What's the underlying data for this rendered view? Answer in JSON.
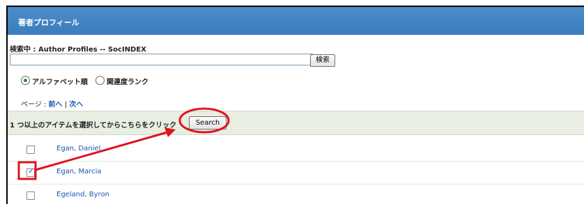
{
  "header": {
    "title": "著者プロフィール"
  },
  "search": {
    "label": "検索中 : Author Profiles -- SocINDEX",
    "placeholder": "",
    "button_label": "検索"
  },
  "sort": {
    "options": [
      {
        "label": "アルファベット順",
        "selected": true
      },
      {
        "label": "関連度ランク",
        "selected": false
      }
    ]
  },
  "paging": {
    "prefix": "ページ : ",
    "prev": "前へ",
    "separator": " | ",
    "next": "次へ"
  },
  "results": {
    "instruction": "1 つ以上のアイテムを選択してからこちらをクリック",
    "button_label": "Search",
    "items": [
      {
        "name": "Egan, Daniel",
        "checked": false
      },
      {
        "name": "Egan, Marcia",
        "checked": true
      },
      {
        "name": "Egeland, Byron",
        "checked": false
      }
    ]
  },
  "colors": {
    "header": "#3a7dbd",
    "link": "#1a55b5",
    "annotation": "#e0141e",
    "results_bar": "#e8eee2"
  }
}
